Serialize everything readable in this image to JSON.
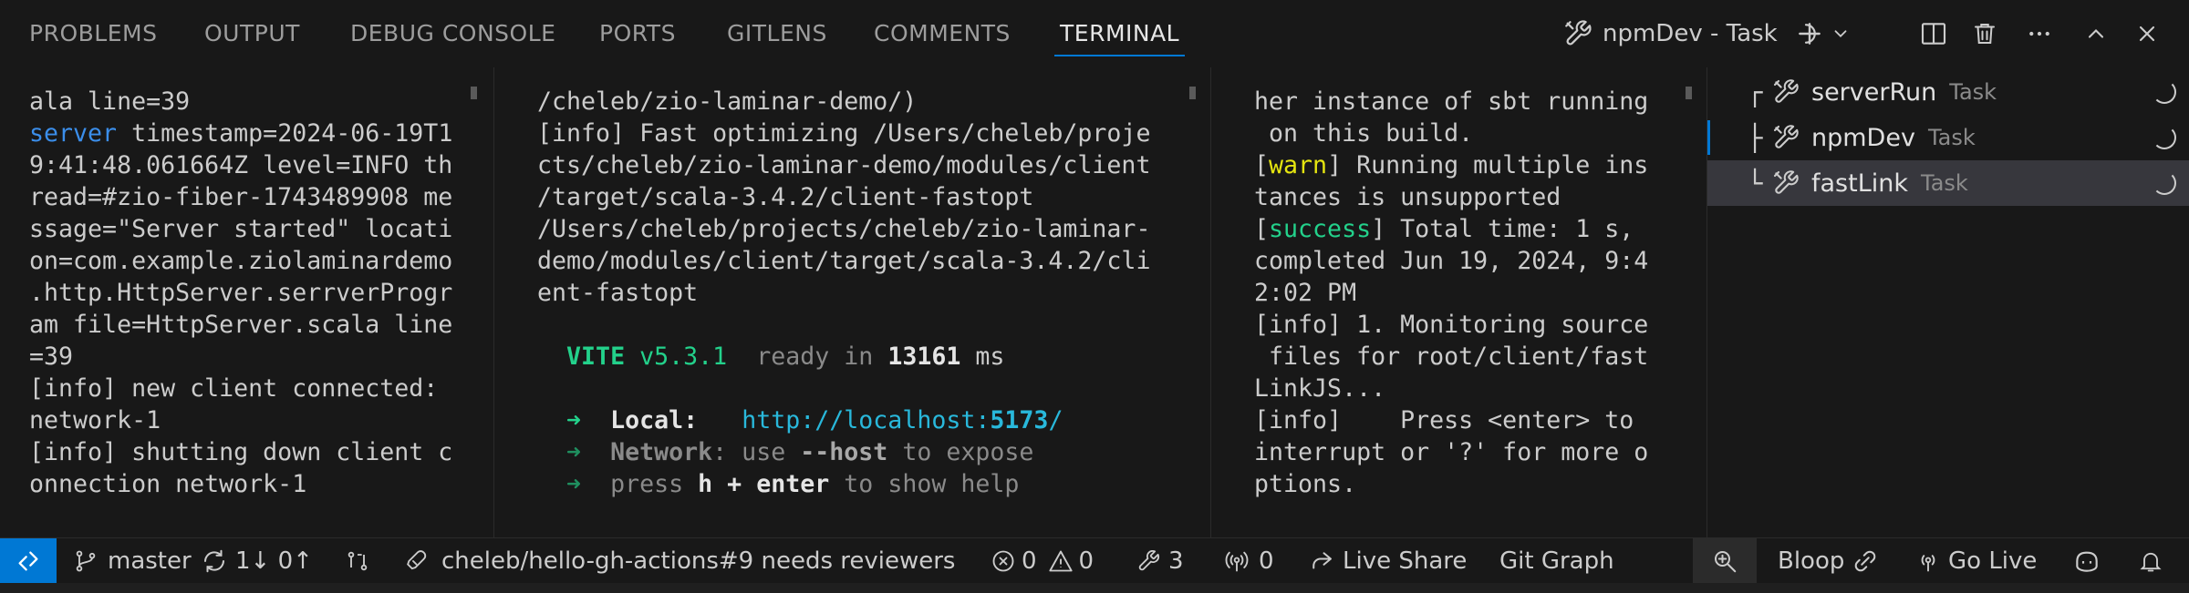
{
  "panel": {
    "tabs": [
      {
        "label": "PROBLEMS"
      },
      {
        "label": "OUTPUT"
      },
      {
        "label": "DEBUG CONSOLE"
      },
      {
        "label": "PORTS"
      },
      {
        "label": "GITLENS"
      },
      {
        "label": "COMMENTS"
      },
      {
        "label": "TERMINAL"
      }
    ],
    "active_tab": "TERMINAL",
    "task_title": "npmDev - Task"
  },
  "terminal1": {
    "lines": [
      [
        "ala line=39"
      ],
      [
        "server",
        " timestamp=2024-06-19T1"
      ],
      [
        "9:41:48.061664Z level=INFO th"
      ],
      [
        "read=#zio-fiber-1743489908 me"
      ],
      [
        "ssage=\"Server started\" locati"
      ],
      [
        "on=com.example.ziolaminardemo"
      ],
      [
        ".http.HttpServer.serrverProgr"
      ],
      [
        "am file=HttpServer.scala line"
      ],
      [
        "=39"
      ],
      [
        "[info] new client connected: "
      ],
      [
        "network-1"
      ],
      [
        "[info] shutting down client c"
      ],
      [
        "onnection network-1"
      ]
    ]
  },
  "terminal2": {
    "lines": [
      "/cheleb/zio-laminar-demo/)",
      "[info] Fast optimizing /Users/cheleb/proje",
      "cts/cheleb/zio-laminar-demo/modules/client",
      "/target/scala-3.4.2/client-fastopt",
      "/Users/cheleb/projects/cheleb/zio-laminar-",
      "demo/modules/client/target/scala-3.4.2/cli",
      "ent-fastopt"
    ],
    "vite_name": "VITE",
    "vite_version": "v5.3.1",
    "ready_text": "ready in",
    "ready_ms": "13161",
    "ms_unit": "ms",
    "arrow": "➜",
    "local_label": "Local:",
    "local_url_prefix": "http://localhost:",
    "local_port": "5173",
    "local_url_suffix": "/",
    "network_label": "Network",
    "network_rest": ": use",
    "network_flag": "--host",
    "network_tail": "to expose",
    "help_prefix": "press",
    "help_keys": "h + enter",
    "help_tail": "to show help"
  },
  "terminal3": {
    "lines": [
      "her instance of sbt running",
      " on this build.",
      "",
      "tances is unsupported",
      "",
      "completed Jun 19, 2024, 9:4",
      "2:02 PM",
      "[info] 1. Monitoring source",
      " files for root/client/fast",
      "LinkJS...",
      "[info]    Press <enter> to ",
      "interrupt or '?' for more o",
      "ptions."
    ],
    "warn_tag": "warn",
    "warn_text": "] Running multiple ins",
    "success_tag": "success",
    "success_text": "] Total time: 1 s,"
  },
  "tasks": [
    {
      "name": "serverRun",
      "kind": "Task",
      "tree": "┌"
    },
    {
      "name": "npmDev",
      "kind": "Task",
      "tree": "├"
    },
    {
      "name": "fastLink",
      "kind": "Task",
      "tree": "└"
    }
  ],
  "statusbar": {
    "branch": "master",
    "sync": "1↓ 0↑",
    "pr": "cheleb/hello-gh-actions#9 needs reviewers",
    "errors": "0",
    "warnings": "0",
    "tasks": "3",
    "ports": "0",
    "live_share": "Live Share",
    "git_graph": "Git Graph",
    "bloop": "Bloop",
    "go_live": "Go Live"
  },
  "colors": {
    "accent": "#0078d4",
    "background": "#181818",
    "server_keyword": "#3b8eea",
    "vite_green": "#23d18b",
    "url_cyan": "#29b8db",
    "warn_yellow": "#e5e510"
  }
}
